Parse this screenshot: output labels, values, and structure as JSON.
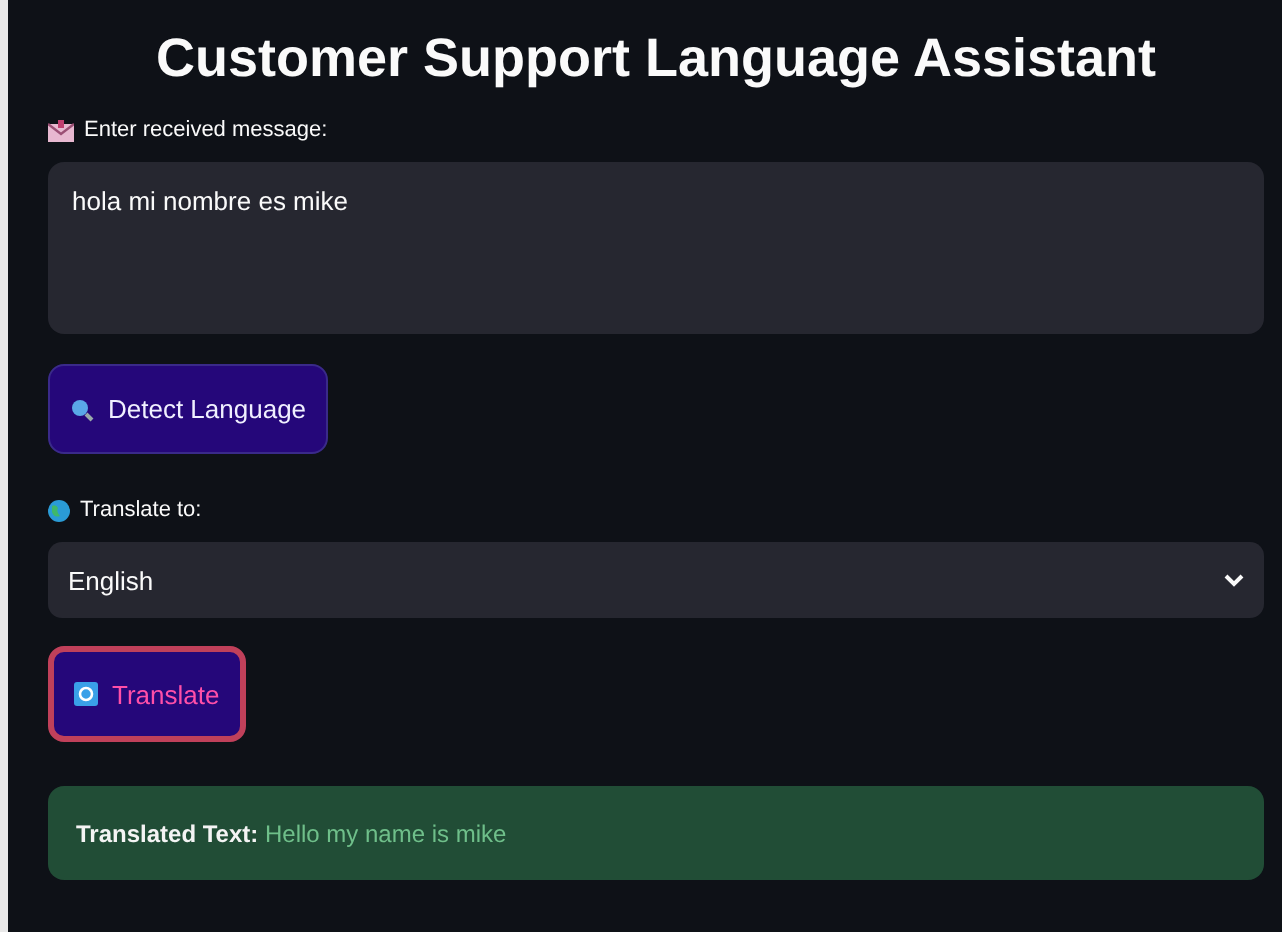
{
  "title": "Customer Support Language Assistant",
  "message_field": {
    "label": "Enter received message:",
    "value": "hola mi nombre es mike"
  },
  "detect_button": {
    "label": "Detect Language",
    "focused": false
  },
  "language_select": {
    "label": "Translate to:",
    "value": "English"
  },
  "translate_button": {
    "label": "Translate",
    "focused": true
  },
  "result": {
    "text": "**Translated Text:** Hello my name is mike"
  }
}
